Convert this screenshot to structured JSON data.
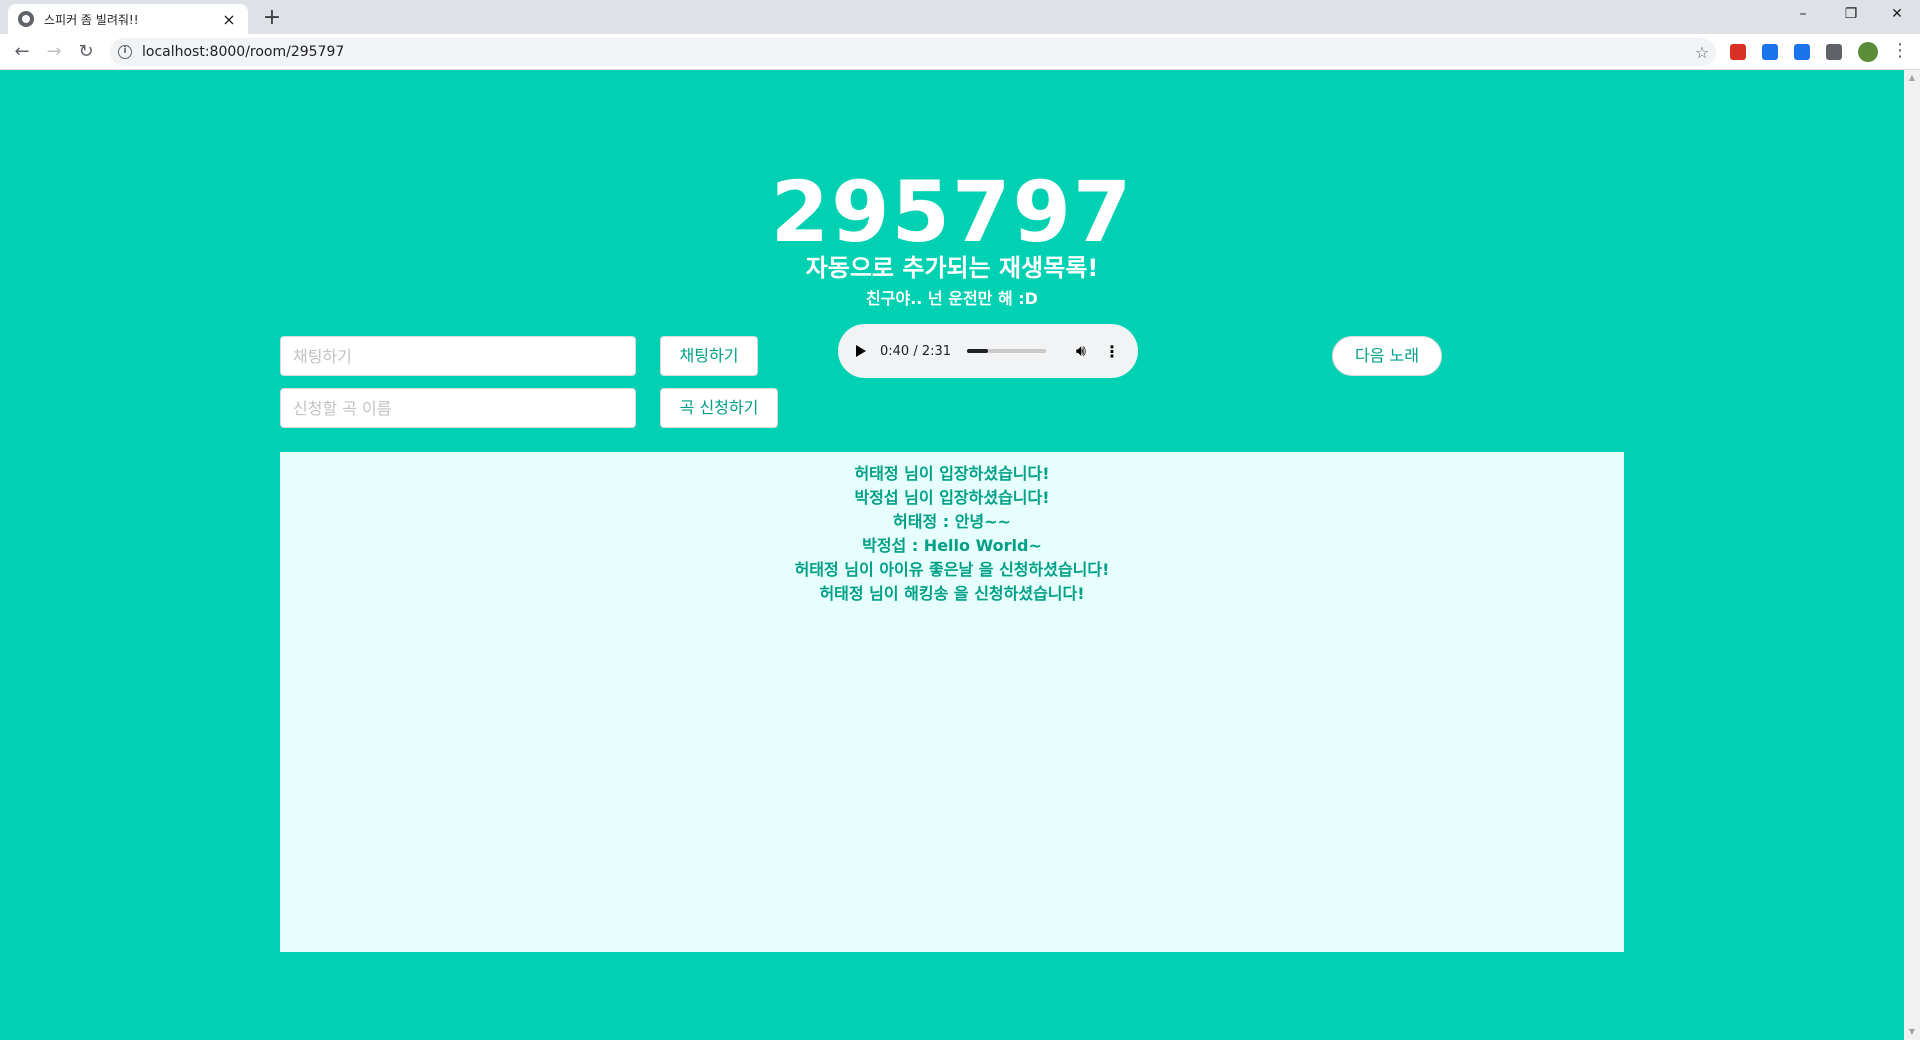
{
  "browser": {
    "tab_title": "스피커 좀 빌려줘!!",
    "tab_close": "×",
    "new_tab": "+",
    "url": "localhost:8000/room/295797",
    "window": {
      "minimize": "–",
      "maximize": "❐",
      "close": "✕"
    },
    "extension_colors": [
      "#d93025",
      "#1a73e8",
      "#1a73e8",
      "#5f6368",
      "#5b8c3a"
    ]
  },
  "header": {
    "room_number": "295797",
    "subtitle": "자동으로 추가되는 재생목록!",
    "tagline": "친구야.. 넌 운전만 해 :D"
  },
  "chat_form": {
    "placeholder": "채팅하기",
    "button_label": "채팅하기"
  },
  "song_form": {
    "placeholder": "신청할 곡 이름",
    "button_label": "곡 신청하기"
  },
  "player": {
    "time": "0:40 / 2:31",
    "progress": 0.265
  },
  "next_song_label": "다음 노래",
  "chat_messages": [
    "허태정 님이 입장하셨습니다!",
    "박정섭 님이 입장하셨습니다!",
    "허태정 : 안녕~~",
    "박정섭 : Hello World~",
    "허태정 님이 아이유 좋은날 을 신청하셨습니다!",
    "허태정 님이 해킹송 을 신청하셨습니다!"
  ],
  "colors": {
    "background": "#00d1b2",
    "accent_text": "#00a087",
    "chat_bg": "#e6fffc"
  }
}
